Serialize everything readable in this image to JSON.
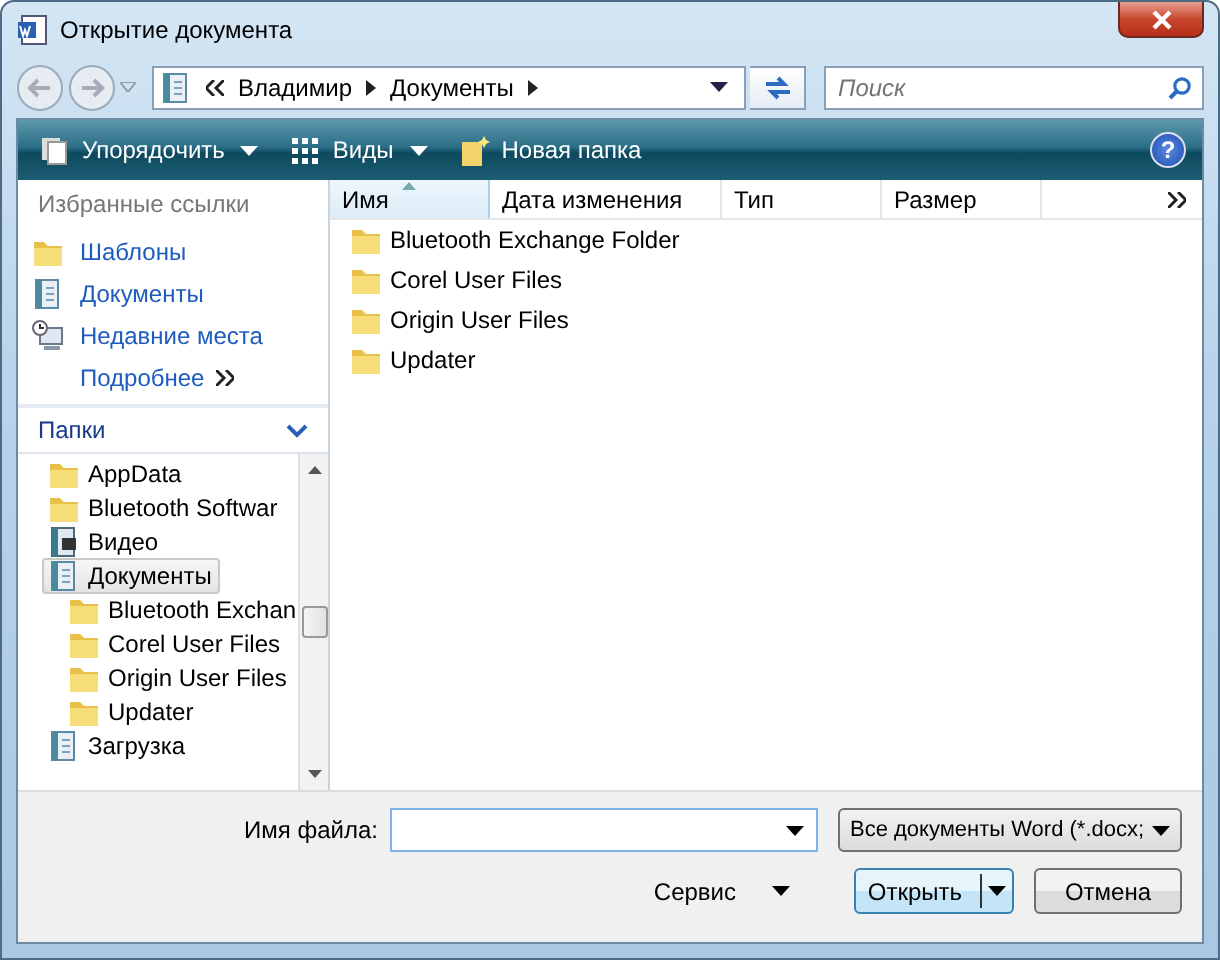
{
  "window": {
    "title": "Открытие документа"
  },
  "address": {
    "crumbs": [
      "Владимир",
      "Документы"
    ]
  },
  "search": {
    "placeholder": "Поиск"
  },
  "toolbar": [
    {
      "label": "Упорядочить",
      "kind": "menu"
    },
    {
      "label": "Виды",
      "kind": "views"
    },
    {
      "label": "Новая папка",
      "kind": "new-folder"
    }
  ],
  "columns": [
    {
      "label": "Имя",
      "sorted": true
    },
    {
      "label": "Дата изменения",
      "sorted": false
    },
    {
      "label": "Тип",
      "sorted": false
    },
    {
      "label": "Размер",
      "sorted": false
    }
  ],
  "files": [
    {
      "name": "Bluetooth Exchange Folder"
    },
    {
      "name": "Corel User Files"
    },
    {
      "name": "Origin User Files"
    },
    {
      "name": "Updater"
    }
  ],
  "help": "?",
  "favorites": {
    "title": "Избранные ссылки",
    "items": [
      {
        "label": "Шаблоны",
        "kind": "folder"
      },
      {
        "label": "Документы",
        "kind": "docs"
      },
      {
        "label": "Недавние места",
        "kind": "recent"
      }
    ],
    "more": "Подробнее"
  },
  "folders": {
    "title": "Папки",
    "expanded": true,
    "tree": [
      {
        "label": "AppData",
        "kind": "folder",
        "selected": false
      },
      {
        "label": "Bluetooth Softwar",
        "kind": "folder",
        "selected": false
      },
      {
        "label": "Видео",
        "kind": "video",
        "selected": false
      },
      {
        "label": "Документы",
        "kind": "docs",
        "selected": true,
        "children": [
          {
            "label": "Bluetooth Exchan",
            "kind": "folder",
            "selected": false
          },
          {
            "label": "Corel User Files",
            "kind": "folder",
            "selected": false
          },
          {
            "label": "Origin User Files",
            "kind": "folder",
            "selected": false
          },
          {
            "label": "Updater",
            "kind": "folder",
            "selected": false
          }
        ]
      },
      {
        "label": "Загрузка",
        "kind": "docs",
        "selected": false
      }
    ]
  },
  "file_name": {
    "label": "Имя файла:"
  },
  "file_type": {
    "value": "Все документы Word (*.docx;"
  },
  "buttons": {
    "tools": "Сервис",
    "open": "Открыть",
    "cancel": "Отмена"
  }
}
